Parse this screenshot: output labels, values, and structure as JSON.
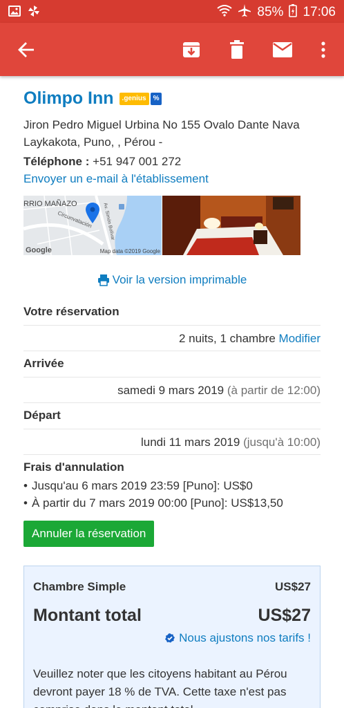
{
  "statusbar": {
    "battery": "85%",
    "time": "17:06"
  },
  "hotel": {
    "name": "Olimpo Inn",
    "genius_badge": ".genius",
    "percent_badge": "%",
    "address_line1": "Jiron Pedro Miguel Urbina No 155 Ovalo Dante Nava",
    "address_line2": "Laykakota, Puno, , Pérou -",
    "phone_label": "Téléphone :",
    "phone_value": "+51 947 001 272",
    "email_link": "Envoyer un e-mail à l'établissement"
  },
  "map": {
    "label_neighborhood": "RRIO MAÑAZO",
    "label_road": "Circunvalación",
    "label_avenue": "Av. Simón Bolívar",
    "google": "Google",
    "map_data": "Map data ©2019 Google"
  },
  "print_link": "Voir la version imprimable",
  "reservation": {
    "heading": "Votre réservation",
    "summary": "2 nuits, 1 chambre",
    "modify": "Modifier"
  },
  "arrival": {
    "heading": "Arrivée",
    "date": "samedi 9 mars 2019",
    "time_note": "(à partir de 12:00)"
  },
  "departure": {
    "heading": "Départ",
    "date": "lundi 11 mars 2019",
    "time_note": "(jusqu'à 10:00)"
  },
  "cancellation": {
    "heading": "Frais d'annulation",
    "items": [
      "Jusqu'au 6 mars 2019 23:59 [Puno]: US$0",
      "À partir du 7 mars 2019 00:00 [Puno]: US$13,50"
    ],
    "button": "Annuler la réservation"
  },
  "price": {
    "room_label": "Chambre Simple",
    "room_price": "US$27",
    "total_label": "Montant total",
    "total_price": "US$27",
    "adjust_link": "Nous ajustons nos tarifs !",
    "note": "Veuillez noter que les citoyens habitant au Pérou devront payer 18 % de TVA. Cette taxe n'est pas comprise dans le montant total."
  },
  "colors": {
    "statusbar": "#d63b30",
    "appbar": "#e0463b",
    "link": "#0f7dc0",
    "button_green": "#1ba836",
    "price_box": "#ebf3ff"
  }
}
